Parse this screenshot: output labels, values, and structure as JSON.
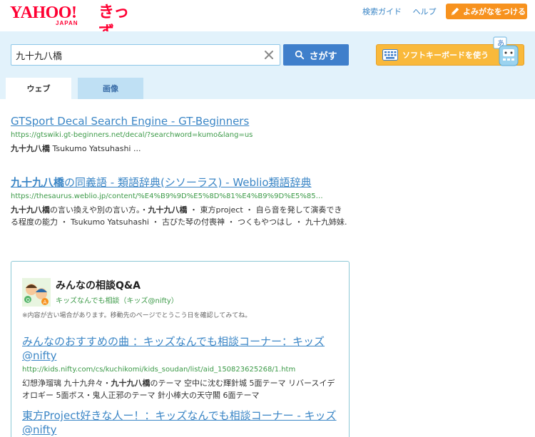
{
  "header": {
    "logo_yahoo": "YAHOO!",
    "logo_japan": "JAPAN",
    "logo_kids": "きっず",
    "links": [
      "検索ガイド",
      "ヘルプ"
    ],
    "yomi_button": "よみがなをつける"
  },
  "search": {
    "query": "九十九八橋",
    "button_label": "さがす",
    "soft_keyboard_label": "ソフトキーボードを使う"
  },
  "tabs": [
    {
      "label": "ウェブ",
      "active": true
    },
    {
      "label": "画像",
      "active": false
    }
  ],
  "results": [
    {
      "title": "GTSport Decal Search Engine - GT-Beginners",
      "url": "https://gtswiki.gt-beginners.net/decal/?searchword=kumo&lang=us",
      "snippet_bold": "九十九八橋",
      "snippet_rest": " Tsukumo Yatsuhashi ..."
    },
    {
      "title_bold": "九十九八橋",
      "title_rest": "の同義語 - 類語辞典(シソーラス) - Weblio類語辞典",
      "url": "https://thesaurus.weblio.jp/content/%E4%B9%9D%E5%8D%81%E4%B9%9D%E5%85…",
      "snippet_bold1": "九十九八橋",
      "snippet_mid1": "の言い換えや別の言い方。・",
      "snippet_bold2": "九十九八橋",
      "snippet_rest": " ・ 東方project ・ 自ら音を発して演奏できる程度の能力 ・ Tsukumo Yatsuhashi ・ 古びた琴の付喪神 ・ つくもやつはし ・ 九十九姉妹."
    }
  ],
  "qa": {
    "title": "みんなの相談Q&A",
    "subtitle": "キッズなんでも相談（キッズ@nifty）",
    "note": "※内容が古い場合があります。移動先のページでとうこう日を確認してみてね。",
    "items": [
      {
        "title": "みんなのおすすめの曲 ：キッズなんでも相談コーナー：キッズ@nifty",
        "url": "http://kids.nifty.com/cs/kuchikomi/kids_soudan/list/aid_150823625268/1.htm",
        "snippet_pre": "幻想浄瑠璃 九十九弁々・",
        "snippet_bold": "九十九八橋",
        "snippet_rest": "のテーマ 空中に沈む輝針城 5面テーマ リバースイデオロギー 5面ボス・鬼人正邪のテーマ 針小棒大の天守閣 6面テーマ"
      },
      {
        "title": "東方Project好きな人ー！：キッズなんでも相談コーナー - キッズ@nifty"
      }
    ]
  },
  "colors": {
    "brand_red": "#ff0033",
    "link_blue": "#3b86c6",
    "url_green": "#3c9a48",
    "search_band": "#e2f2fb",
    "orange": "#f7921e"
  }
}
